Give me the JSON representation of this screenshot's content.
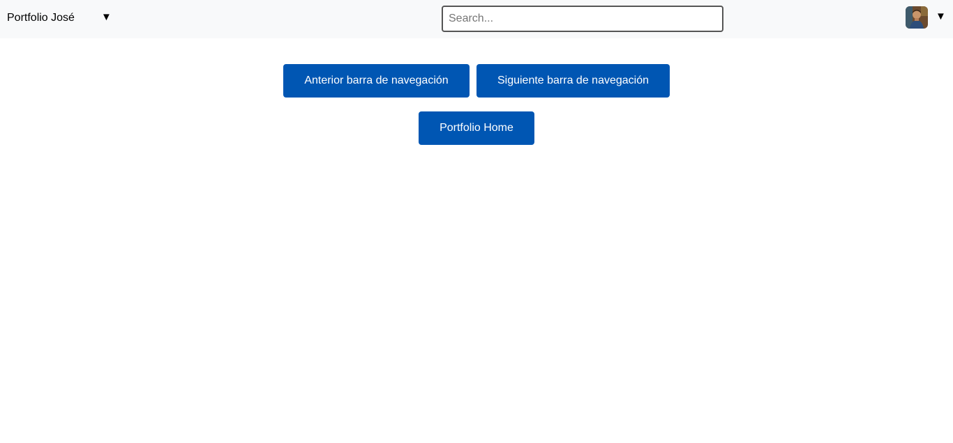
{
  "navbar": {
    "brand": "Portfolio José",
    "brand_caret": "▼",
    "search_placeholder": "Search...",
    "search_value": "",
    "user_caret": "▼",
    "avatar_icon": "user-avatar-photo"
  },
  "main": {
    "prev_button": "Anterior barra de navegación",
    "next_button": "Siguiente barra de navegación",
    "home_button": "Portfolio Home"
  },
  "colors": {
    "navbar_bg": "#f8f9fa",
    "button_bg": "#0056b3",
    "button_text": "#ffffff"
  }
}
